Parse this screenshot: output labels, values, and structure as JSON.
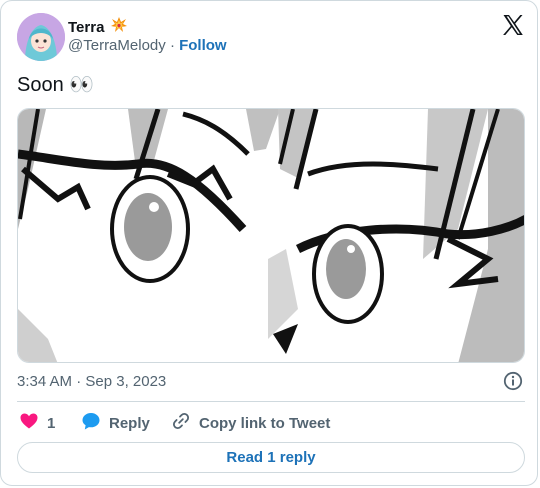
{
  "author": {
    "name": "Terra",
    "handle": "@TerraMelody",
    "separator": "·",
    "follow_label": "Follow",
    "badge_icon": "collision-emoji"
  },
  "tweet": {
    "text": "Soon 👀",
    "timestamp": "3:34 AM · Sep 3, 2023"
  },
  "actions": {
    "like_count": "1",
    "reply_label": "Reply",
    "copy_label": "Copy link to Tweet"
  },
  "footer": {
    "read_replies_label": "Read 1 reply"
  },
  "colors": {
    "like": "#f91880",
    "reply": "#1d9bf0",
    "link": "#1d72b8",
    "muted": "#536471",
    "border": "#cfd9de"
  }
}
